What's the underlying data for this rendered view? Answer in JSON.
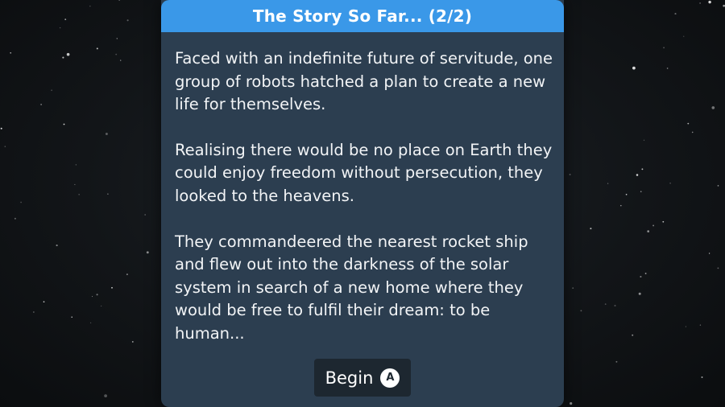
{
  "dialog": {
    "title": "The Story So Far... (2/2)",
    "paragraphs": [
      "Faced with an indefinite future of servitude, one group of robots hatched a plan to create a new life for themselves.",
      "Realising there would be no place on Earth they could enjoy freedom without persecution, they looked to the heavens.",
      "They commandeered the nearest rocket ship and flew out into the darkness of the solar system in search of a new home where they would be free to fulfil their dream: to be human..."
    ],
    "begin_button": {
      "label": "Begin",
      "button_glyph": "A",
      "icon": "a-button-icon"
    }
  },
  "colors": {
    "header": "#3a98e8",
    "panel": "#2c3e50",
    "button": "#1d2730",
    "background": "#121518"
  }
}
